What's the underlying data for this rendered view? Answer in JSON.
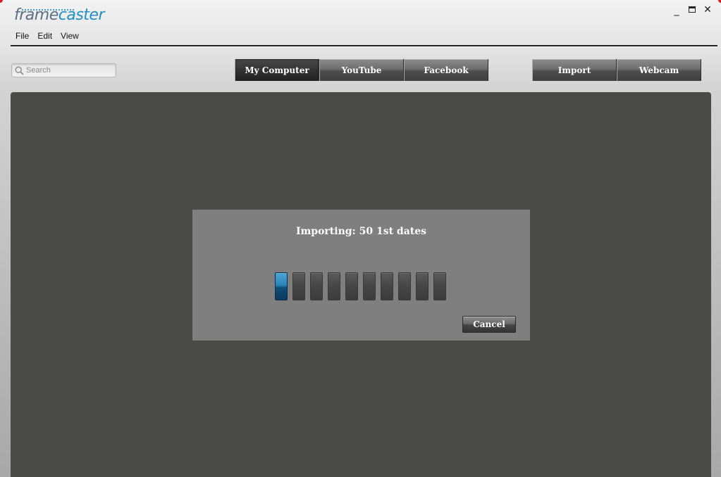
{
  "app": {
    "logo_part1": "frame",
    "logo_part2": "caster",
    "minimize_glyph": "_",
    "close_glyph": "✕"
  },
  "menu": {
    "items": [
      "File",
      "Edit",
      "View"
    ]
  },
  "search": {
    "placeholder": "Search",
    "value": ""
  },
  "source_tabs": [
    {
      "label": "My Computer",
      "active": true
    },
    {
      "label": "YouTube",
      "active": false
    },
    {
      "label": "Facebook",
      "active": false
    }
  ],
  "actions": [
    {
      "label": "Import"
    },
    {
      "label": "Webcam"
    }
  ],
  "import_dialog": {
    "title": "Importing: 50 1st dates",
    "progress_filled_blocks": 1,
    "progress_total_blocks": 10,
    "cancel_label": "Cancel"
  },
  "colors": {
    "accent": "#1e8fc8",
    "content_bg": "#4a4a48",
    "dialog_bg": "#7f7f7f"
  }
}
